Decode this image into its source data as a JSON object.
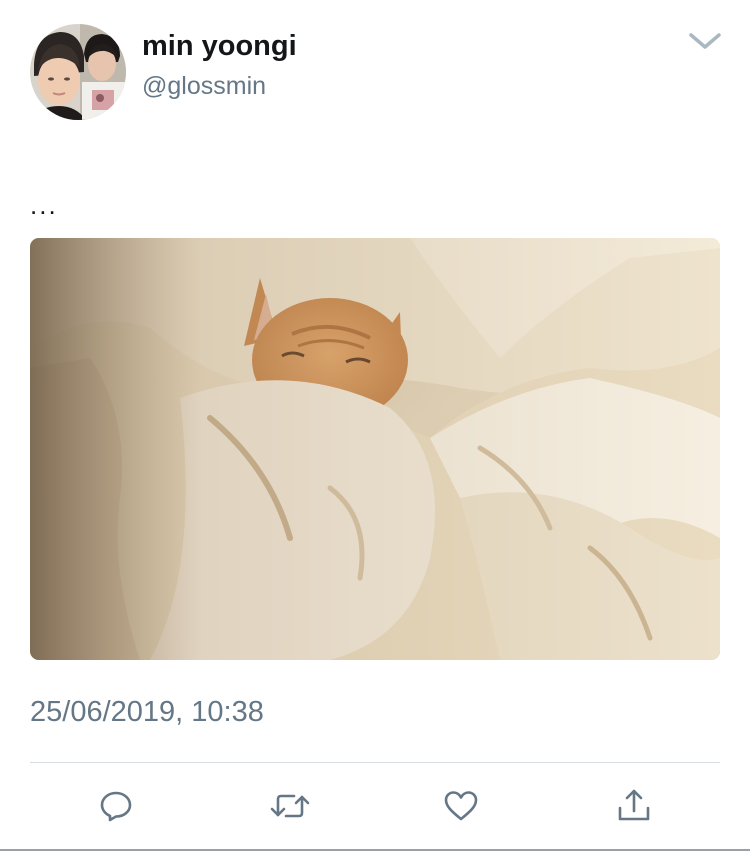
{
  "user": {
    "display_name": "min yoongi",
    "handle": "@glossmin"
  },
  "tweet": {
    "text": "...",
    "timestamp": "25/06/2019, 10:38"
  },
  "icons": {
    "menu": "chevron-down-icon",
    "reply": "reply-icon",
    "retweet": "retweet-icon",
    "like": "heart-icon",
    "share": "share-icon"
  },
  "colors": {
    "text_primary": "#14171a",
    "text_secondary": "#657786",
    "icon": "#657786",
    "divider": "#d8dde1"
  }
}
